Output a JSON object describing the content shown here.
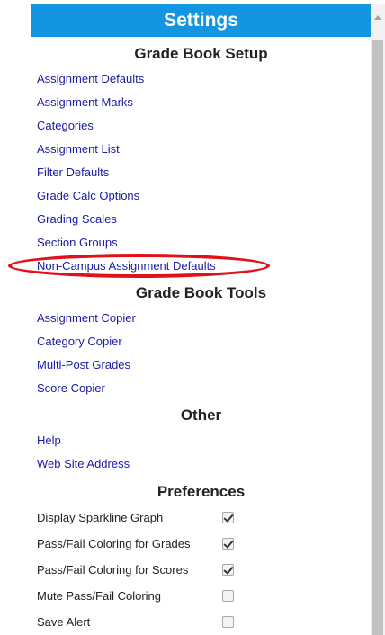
{
  "header": {
    "title": "Settings"
  },
  "sections": {
    "setup": {
      "title": "Grade Book Setup",
      "links": [
        "Assignment Defaults",
        "Assignment Marks",
        "Categories",
        "Assignment List",
        "Filter Defaults",
        "Grade Calc Options",
        "Grading Scales",
        "Section Groups",
        "Non-Campus Assignment Defaults"
      ]
    },
    "tools": {
      "title": "Grade Book Tools",
      "links": [
        "Assignment Copier",
        "Category Copier",
        "Multi-Post Grades",
        "Score Copier"
      ]
    },
    "other": {
      "title": "Other",
      "links": [
        "Help",
        "Web Site Address"
      ]
    },
    "preferences": {
      "title": "Preferences",
      "items": [
        {
          "label": "Display Sparkline Graph",
          "checked": true
        },
        {
          "label": "Pass/Fail Coloring for Grades",
          "checked": true
        },
        {
          "label": "Pass/Fail Coloring for Scores",
          "checked": true
        },
        {
          "label": "Mute Pass/Fail Coloring",
          "checked": false
        },
        {
          "label": "Save Alert",
          "checked": false
        }
      ]
    }
  },
  "annotation": {
    "highlighted_item": "Non-Campus Assignment Defaults",
    "color": "#e3101a"
  },
  "colors": {
    "header_bg": "#1396e2",
    "link": "#1a1aa6"
  }
}
